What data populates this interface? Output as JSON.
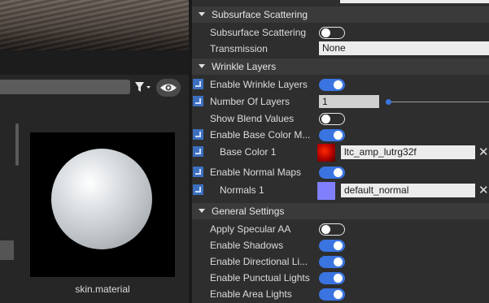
{
  "assets": {
    "search_placeholder": "",
    "thumbnail_label": "skin.material"
  },
  "inspector": {
    "sections": {
      "subsurface": "Subsurface Scattering",
      "wrinkle": "Wrinkle Layers",
      "general": "General Settings"
    },
    "rows": {
      "subsurface_scattering": {
        "label": "Subsurface Scattering",
        "value": false
      },
      "transmission": {
        "label": "Transmission",
        "value": "None"
      },
      "enable_wrinkle_layers": {
        "label": "Enable Wrinkle Layers",
        "value": true
      },
      "number_of_layers": {
        "label": "Number Of Layers",
        "value": "1"
      },
      "show_blend_values": {
        "label": "Show Blend Values",
        "value": false
      },
      "enable_base_color_maps": {
        "label": "Enable Base Color M...",
        "value": true
      },
      "base_color_1": {
        "label": "Base Color 1",
        "texture": "ltc_amp_lutrg32f",
        "swatch": "#cc0000"
      },
      "enable_normal_maps": {
        "label": "Enable Normal Maps",
        "value": true
      },
      "normals_1": {
        "label": "Normals 1",
        "texture": "default_normal",
        "swatch": "#8080ff"
      },
      "apply_specular_aa": {
        "label": "Apply Specular AA",
        "value": false
      },
      "enable_shadows": {
        "label": "Enable Shadows",
        "value": true
      },
      "enable_directional_lights": {
        "label": "Enable Directional Li...",
        "value": true
      },
      "enable_punctual_lights": {
        "label": "Enable Punctual Lights",
        "value": true
      },
      "enable_area_lights": {
        "label": "Enable Area Lights",
        "value": true
      }
    }
  },
  "colors": {
    "accent": "#3a74e0",
    "panel_bg": "#2e2e2e",
    "header_bg": "#3a3a3a"
  },
  "icons": [
    "filter-icon",
    "dropdown-arrow-icon",
    "eye-icon",
    "collapse-triangle-icon",
    "property-bind-icon",
    "clear-icon"
  ]
}
